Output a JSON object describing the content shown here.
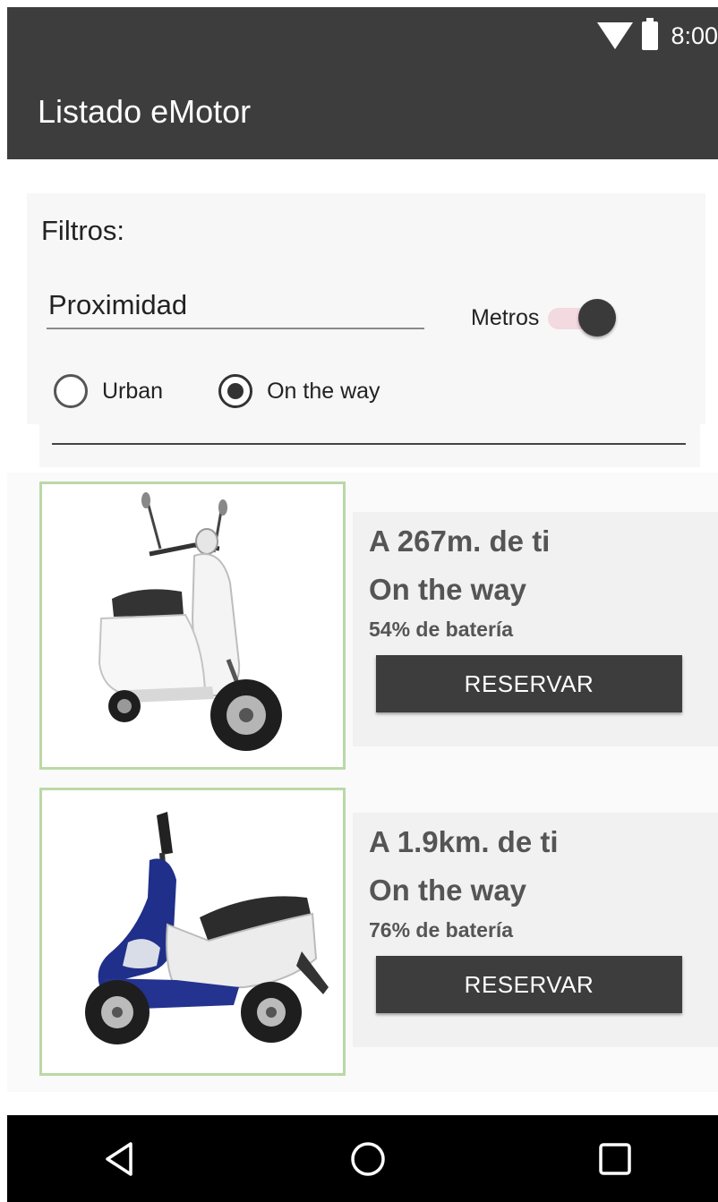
{
  "status_bar": {
    "time": "8:00"
  },
  "app_bar": {
    "title": "Listado eMotor"
  },
  "filters": {
    "label": "Filtros:",
    "proximity_value": "Proximidad",
    "metros_label": "Metros",
    "metros_enabled": true,
    "radios": [
      {
        "label": "Urban",
        "checked": false
      },
      {
        "label": "On the way",
        "checked": true
      }
    ]
  },
  "listings": [
    {
      "distance": "A 267m. de ti",
      "type": "On the way",
      "battery": "54% de batería",
      "button": "RESERVAR",
      "image": "white-scooter"
    },
    {
      "distance": "A 1.9km. de ti",
      "type": "On the way",
      "battery": "76% de batería",
      "button": "RESERVAR",
      "image": "blue-scooter"
    }
  ],
  "colors": {
    "app_bar": "#3d3d3d",
    "button": "#3d3d3d",
    "photo_border": "#b9d9a6",
    "switch_track": "#f3d9e0"
  },
  "nav": {
    "back": "back-icon",
    "home": "home-icon",
    "recents": "recents-icon"
  }
}
